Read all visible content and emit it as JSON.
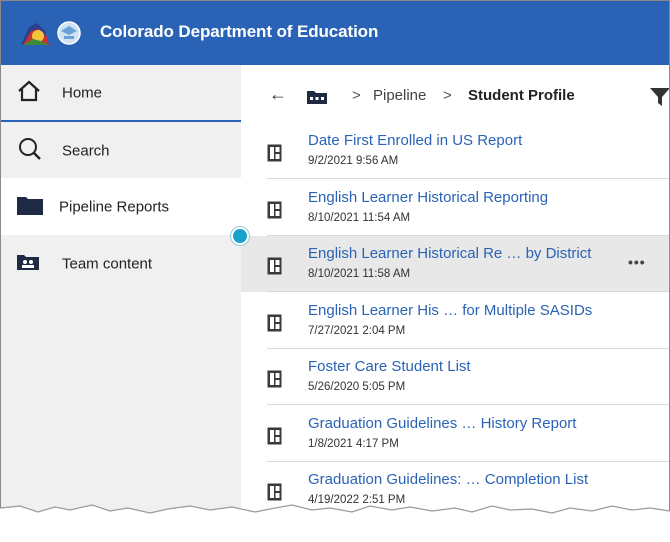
{
  "header": {
    "title": "Colorado Department of Education"
  },
  "sidebar": {
    "items": [
      {
        "label": "Home",
        "icon": "home-icon"
      },
      {
        "label": "Search",
        "icon": "search-icon"
      },
      {
        "label": "Pipeline Reports",
        "icon": "folder-icon"
      },
      {
        "label": "Team content",
        "icon": "team-folder-icon"
      }
    ]
  },
  "breadcrumb": {
    "back_icon": "back-arrow-icon",
    "folder_icon": "folder-icon",
    "separator": ">",
    "pipeline": "Pipeline",
    "current": "Student Profile",
    "filter_icon": "filter-icon"
  },
  "reports": [
    {
      "title": "Date First Enrolled in US Report",
      "date": "9/2/2021 9:56 AM"
    },
    {
      "title": "English Learner Historical Reporting",
      "date": "8/10/2021 11:54 AM"
    },
    {
      "title": "English Learner Historical Re … by District",
      "date": "8/10/2021 11:58 AM",
      "more": "•••"
    },
    {
      "title": "English Learner His … for Multiple SASIDs",
      "date": "7/27/2021 2:04 PM"
    },
    {
      "title": "Foster Care Student List",
      "date": "5/26/2020 5:05 PM"
    },
    {
      "title": "Graduation Guidelines … History Report",
      "date": "1/8/2021 4:17 PM"
    },
    {
      "title": "Graduation Guidelines: … Completion List",
      "date": "4/19/2022 2:51 PM"
    }
  ],
  "colors": {
    "header": "#2a63b6",
    "link": "#2a63b6",
    "sidebar": "#f0f0f0",
    "accent_dot": "#1aa1c9"
  }
}
